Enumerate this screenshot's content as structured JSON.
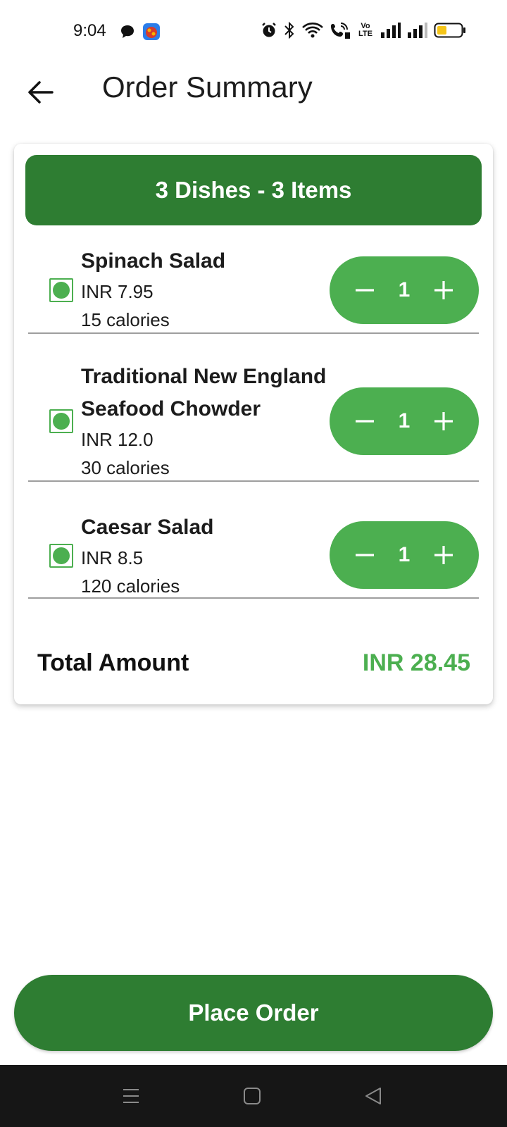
{
  "status_bar": {
    "time": "9:04",
    "left_icons": [
      "chat-bubble-icon",
      "app-notification-icon"
    ],
    "right_icons": [
      "alarm-icon",
      "bluetooth-icon",
      "wifi-icon",
      "wifi-calling-icon",
      "volte-icon",
      "signal-icon",
      "signal-icon",
      "battery-icon"
    ],
    "volte_text": "Vo LTE"
  },
  "app_bar": {
    "title": "Order Summary"
  },
  "summary": {
    "header": "3 Dishes - 3 Items",
    "dishes": [
      {
        "name": "Spinach Salad",
        "price": "INR 7.95",
        "calories": "15 calories",
        "quantity": "1"
      },
      {
        "name": "Traditional New England Seafood Chowder",
        "price": "INR 12.0",
        "calories": "30 calories",
        "quantity": "1"
      },
      {
        "name": "Caesar Salad",
        "price": "INR 8.5",
        "calories": "120 calories",
        "quantity": "1"
      }
    ],
    "total_label": "Total Amount",
    "total_value": "INR 28.45"
  },
  "place_order_label": "Place Order",
  "colors": {
    "primary_dark": "#2e7d32",
    "primary": "#4caf50",
    "nav_bar": "#161616"
  }
}
